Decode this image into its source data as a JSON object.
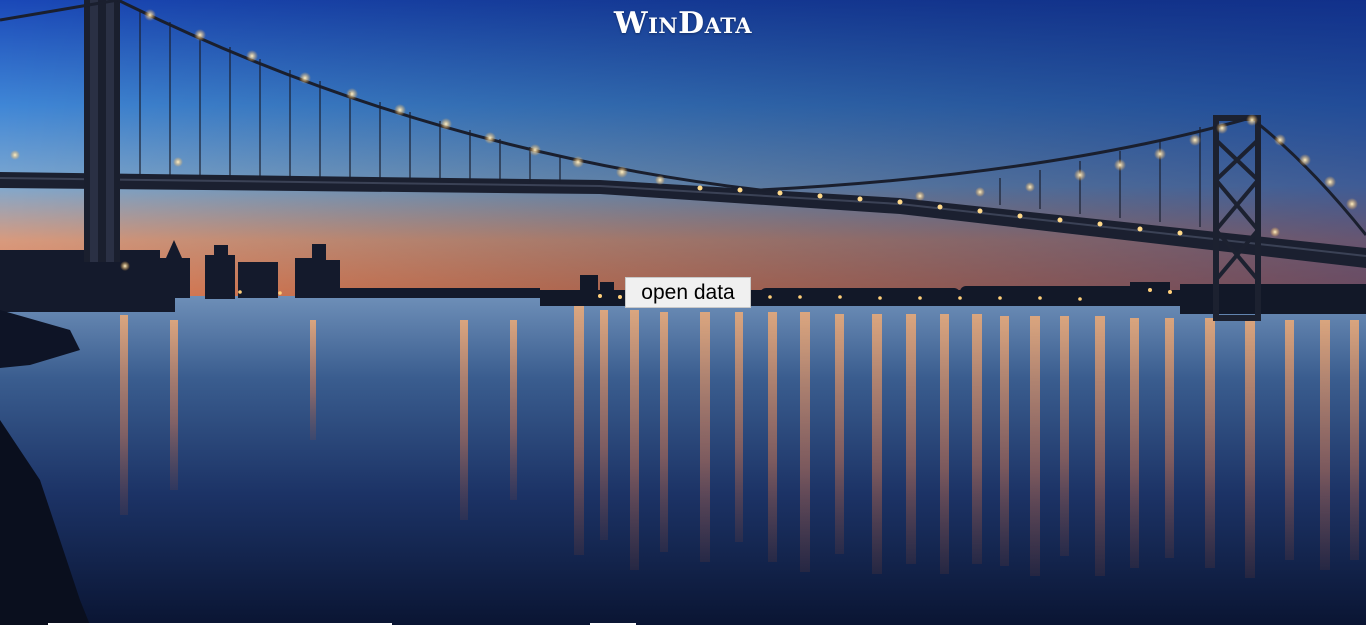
{
  "header": {
    "title": "WinData"
  },
  "main": {
    "open_data_label": "open data"
  },
  "background": {
    "scene": "suspension-bridge-at-dusk",
    "colors": {
      "sky_top": "#1436a0",
      "sky_mid": "#4b8fd6",
      "horizon_glow": "#e8865a",
      "water_dark": "#0c1838",
      "light_warm": "#ffd07a"
    }
  }
}
